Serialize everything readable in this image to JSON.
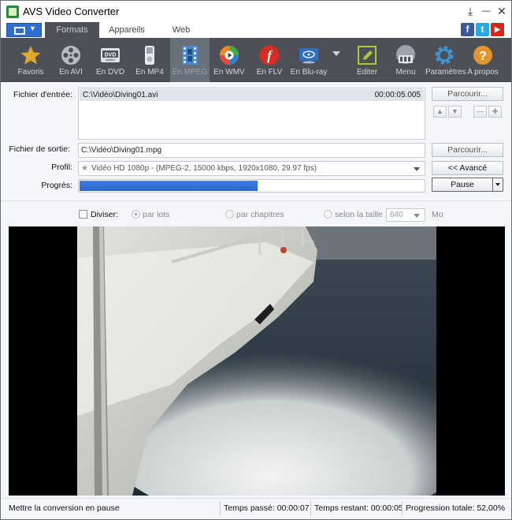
{
  "window": {
    "title": "AVS Video Converter"
  },
  "title_buttons": {
    "pin": "⤓",
    "minimize": "—",
    "close": "✕"
  },
  "tabs": [
    "Formats",
    "Appareils",
    "Web"
  ],
  "social": {
    "facebook": "f",
    "twitter": "t",
    "youtube": "▶"
  },
  "toolbar": {
    "items": [
      {
        "label": "Favoris",
        "icon": "star-icon"
      },
      {
        "label": "En AVI",
        "icon": "film-reel-icon"
      },
      {
        "label": "En DVD",
        "icon": "dvd-icon"
      },
      {
        "label": "En MP4",
        "icon": "mp4-player-icon"
      },
      {
        "label": "En MPEG",
        "icon": "mpeg-film-icon"
      },
      {
        "label": "En WMV",
        "icon": "wmv-icon"
      },
      {
        "label": "En FLV",
        "icon": "flash-icon"
      },
      {
        "label": "En Blu-ray",
        "icon": "blu-ray-icon"
      },
      {
        "label": "Editer",
        "icon": "edit-icon"
      },
      {
        "label": "Menu",
        "icon": "menu-icon"
      },
      {
        "label": "Paramètres",
        "icon": "gear-icon"
      },
      {
        "label": "A propos",
        "icon": "question-icon"
      }
    ],
    "selected": "En MPEG"
  },
  "form": {
    "input_label": "Fichier d'entrée:",
    "input_file": "C:\\Vidéo\\Diving01.avi",
    "input_duration": "00:00:05.005",
    "browse_label": "Parcourir...",
    "output_label": "Fichier de sortie:",
    "output_file": "C:\\Vidéo\\Diving01.mpg",
    "profile_label": "Profil:",
    "profile_value": "Vidéo HD 1080p - (MPEG-2, 15000 kbps, 1920x1080, 29.97 fps)",
    "advanced_label": "<< Avancé",
    "progress_label": "Progrès:",
    "progress_fraction": 0.52,
    "pause_label": "Pause",
    "arrow_up": "▲",
    "arrow_down": "▼",
    "remove": "—",
    "add": "✚"
  },
  "split": {
    "label": "Diviser:",
    "by_lots": "par lots",
    "by_chapters": "par chapitres",
    "by_size": "selon la taille",
    "size_value": "640",
    "size_unit": "Mo"
  },
  "status": {
    "action": "Mettre la conversion en pause",
    "elapsed": "Temps passé: 00:00:07",
    "remaining": "Temps restant: 00:00:05",
    "total": "Progression totale: 52,00%"
  },
  "colors": {
    "accent": "#2f6fd0",
    "toolbar": "#4d5157",
    "progress": "#3d7fe0"
  }
}
